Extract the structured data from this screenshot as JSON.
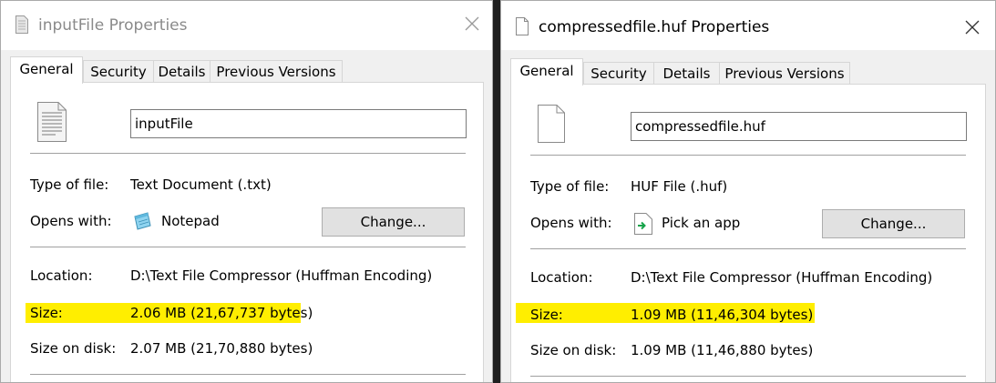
{
  "left": {
    "title": "inputFile Properties",
    "tabs": [
      "General",
      "Security",
      "Details",
      "Previous Versions"
    ],
    "file_name": "inputFile",
    "type_label": "Type of file:",
    "type_value": "Text Document (.txt)",
    "opens_label": "Opens with:",
    "opens_value": "Notepad",
    "change_button": "Change...",
    "location_label": "Location:",
    "location_value": "D:\\Text File Compressor (Huffman Encoding)",
    "size_label": "Size:",
    "size_value": "2.06 MB (21,67,737 bytes)",
    "size_on_disk_label": "Size on disk:",
    "size_on_disk_value": "2.07 MB (21,70,880 bytes)"
  },
  "right": {
    "title": "compressedfile.huf Properties",
    "tabs": [
      "General",
      "Security",
      "Details",
      "Previous Versions"
    ],
    "file_name": "compressedfile.huf",
    "type_label": "Type of file:",
    "type_value": "HUF File (.huf)",
    "opens_label": "Opens with:",
    "opens_value": "Pick an app",
    "change_button": "Change...",
    "location_label": "Location:",
    "location_value": "D:\\Text File Compressor (Huffman Encoding)",
    "size_label": "Size:",
    "size_value": "1.09 MB (11,46,304 bytes)",
    "size_on_disk_label": "Size on disk:",
    "size_on_disk_value": "1.09 MB (11,46,880 bytes)"
  },
  "icons": {
    "left_title": "text-document-icon",
    "right_title": "blank-file-icon",
    "close": "close-icon",
    "notepad": "notepad-icon",
    "pick_app": "pick-app-icon"
  },
  "colors": {
    "highlight": "#ffee00",
    "dialog_bg": "#f0f0f0",
    "panel_bg": "#ffffff",
    "button_bg": "#e1e1e1"
  }
}
